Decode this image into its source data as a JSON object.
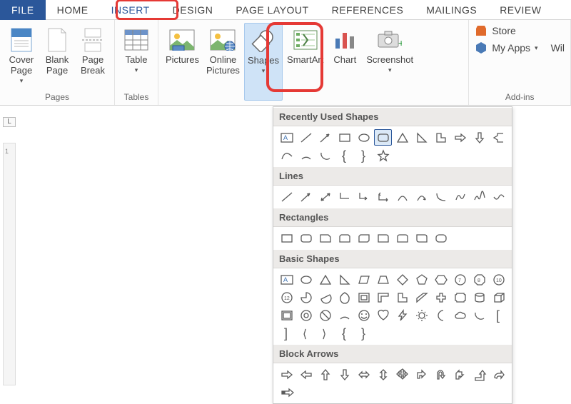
{
  "tabs": {
    "file": "FILE",
    "home": "HOME",
    "insert": "INSERT",
    "design": "DESIGN",
    "page_layout": "PAGE LAYOUT",
    "references": "REFERENCES",
    "mailings": "MAILINGS",
    "review": "REVIEW"
  },
  "ribbon": {
    "pages": {
      "group_label": "Pages",
      "cover_page": "Cover\nPage",
      "blank_page": "Blank\nPage",
      "page_break": "Page\nBreak"
    },
    "tables": {
      "group_label": "Tables",
      "table": "Table"
    },
    "illustrations": {
      "pictures": "Pictures",
      "online_pictures": "Online\nPictures",
      "shapes": "Shapes",
      "smartart": "SmartArt",
      "chart": "Chart",
      "screenshot": "Screenshot"
    },
    "addins": {
      "group_label": "Add-ins",
      "store": "Store",
      "my_apps": "My Apps",
      "wiki": "Wil"
    }
  },
  "ruler_corner": "L",
  "ruler_marks": [
    "1"
  ],
  "shapes_panel": {
    "recently_used": {
      "title": "Recently Used Shapes",
      "items": [
        "text-box",
        "line",
        "line-arrow",
        "rectangle",
        "oval",
        "rounded-rectangle",
        "triangle",
        "right-triangle",
        "l-shape",
        "right-arrow",
        "down-arrow",
        "left-brace-arrow",
        "curve",
        "arc",
        "arc2",
        "left-brace",
        "right-brace",
        "star"
      ]
    },
    "lines": {
      "title": "Lines",
      "items": [
        "line",
        "line-arrow",
        "double-arrow",
        "elbow",
        "elbow-arrow",
        "elbow-double",
        "curved",
        "curved-arrow",
        "curve-conn",
        "freeform",
        "scribble",
        "scribble2"
      ]
    },
    "rectangles": {
      "title": "Rectangles",
      "items": [
        "rect",
        "round-rect",
        "snip-single",
        "snip-same",
        "snip-diag",
        "round-single",
        "round-same",
        "round-diag",
        "round-all"
      ]
    },
    "basic_shapes": {
      "title": "Basic Shapes",
      "items": [
        "text-box",
        "oval",
        "triangle",
        "right-triangle",
        "parallelogram",
        "trapezoid",
        "diamond",
        "pentagon",
        "hexagon",
        "heptagon",
        "octagon",
        "decagon",
        "dodecagon",
        "pie",
        "chord",
        "teardrop",
        "frame",
        "half-frame",
        "l-shape",
        "diagonal-stripe",
        "plus",
        "plaque",
        "can",
        "cube",
        "bevel",
        "donut",
        "no-symbol",
        "arc",
        "smiley",
        "heart",
        "lightning",
        "sun",
        "moon",
        "cloud",
        "arc2",
        "bracket",
        "bracket2",
        "brace",
        "brace2",
        "left-brace",
        "right-brace"
      ]
    },
    "block_arrows": {
      "title": "Block Arrows",
      "items": [
        "right",
        "left",
        "up",
        "down",
        "left-right",
        "up-down",
        "quad",
        "bent",
        "u-turn",
        "left-up",
        "bent-up",
        "curved-right",
        "striped"
      ]
    }
  }
}
